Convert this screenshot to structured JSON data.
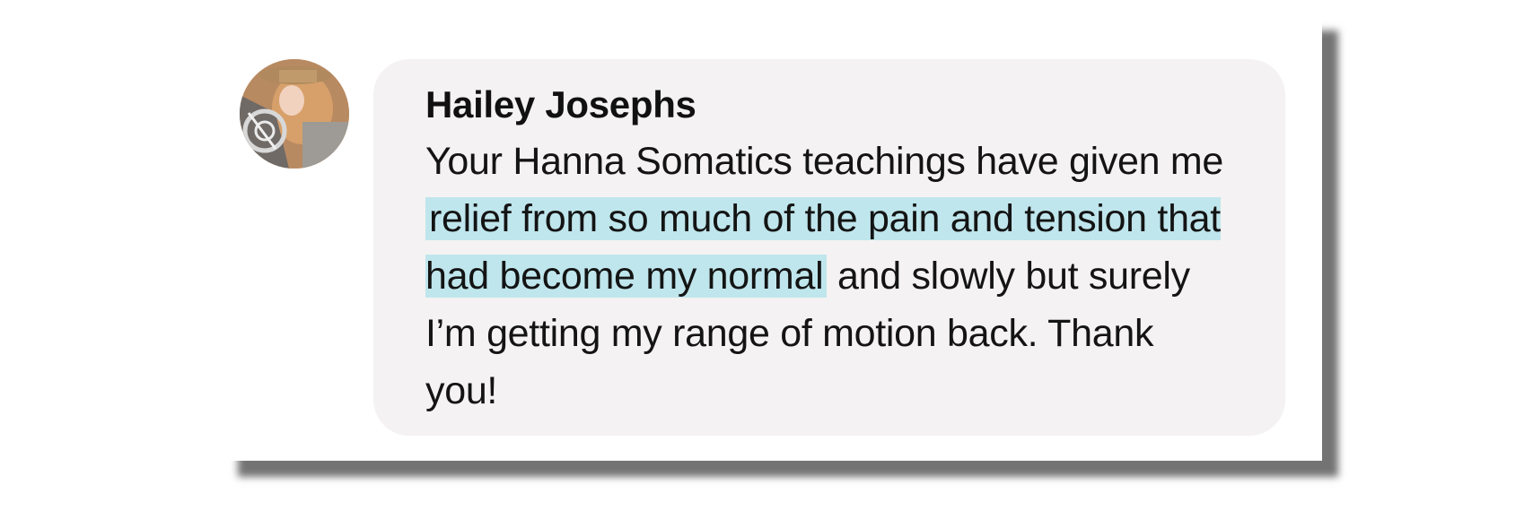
{
  "comment": {
    "author": "Hailey Josephs",
    "text_before": "Your Hanna Somatics teachings have given me",
    "text_highlight": "relief from so much of the pain and tension that had become my normal",
    "text_after": "and slowly but surely I’m getting my range of motion back. Thank you!",
    "highlight_color": "#bfe6ec",
    "bubble_color": "#f4f2f3"
  },
  "avatar": {
    "icon": "profile-photo"
  }
}
